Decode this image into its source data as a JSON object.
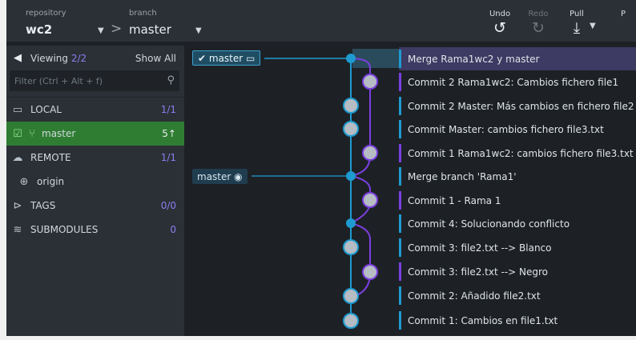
{
  "toolbar": {
    "repo_label": "repository",
    "repo_name": "wc2",
    "branch_label": "branch",
    "branch_name": "master",
    "undo": "Undo",
    "redo": "Redo",
    "pull": "Pull",
    "push_cut": "P"
  },
  "sidebar": {
    "viewing_label": "Viewing",
    "viewing_count": "2/2",
    "show_all": "Show All",
    "filter_placeholder": "Filter (Ctrl + Alt + f)",
    "local": {
      "label": "LOCAL",
      "count": "1/1"
    },
    "branches": [
      {
        "name": "master",
        "status": "5↑"
      }
    ],
    "remote": {
      "label": "REMOTE",
      "count": "1/1"
    },
    "remotes": [
      {
        "name": "origin"
      }
    ],
    "tags": {
      "label": "TAGS",
      "count": "0/0"
    },
    "submodules": {
      "label": "SUBMODULES",
      "count": "0"
    }
  },
  "refs": {
    "head": "master",
    "remote_master": "master"
  },
  "commits": [
    {
      "message": "Merge Rama1wc2 y master",
      "lane": "blue"
    },
    {
      "message": "Commit 2 Rama1wc2: Cambios fichero file1",
      "lane": "purple"
    },
    {
      "message": "Commit 2 Master: Más cambios en fichero file2",
      "lane": "blue"
    },
    {
      "message": "Commit Master: cambios fichero file3.txt",
      "lane": "blue"
    },
    {
      "message": "Commit 1 Rama1wc2: cambios fichero file3.txt",
      "lane": "purple"
    },
    {
      "message": "Merge branch 'Rama1'",
      "lane": "blue"
    },
    {
      "message": "Commit 1 - Rama 1",
      "lane": "purple"
    },
    {
      "message": "Commit 4: Solucionando conflicto",
      "lane": "blue"
    },
    {
      "message": "Commit 3: file2.txt --> Blanco",
      "lane": "blue"
    },
    {
      "message": "Commit 3: file2.txt --> Negro",
      "lane": "purple"
    },
    {
      "message": "Commit 2: Añadido file2.txt",
      "lane": "blue"
    },
    {
      "message": "Commit 1: Cambios en file1.txt",
      "lane": "blue"
    }
  ],
  "colors": {
    "blue_lane": "#1e9bd0",
    "purple_lane": "#7b3fe0",
    "selected_branch": "#2e7d32",
    "count_purple": "#8e7cf0"
  },
  "icons": [
    "chevron-down-icon",
    "chevron-right-icon",
    "undo-icon",
    "redo-icon",
    "pull-icon",
    "viewing-eye-icon",
    "search-icon",
    "laptop-icon",
    "branch-icon",
    "cloud-icon",
    "globe-icon",
    "tag-icon",
    "stack-icon",
    "check-icon",
    "target-icon"
  ]
}
